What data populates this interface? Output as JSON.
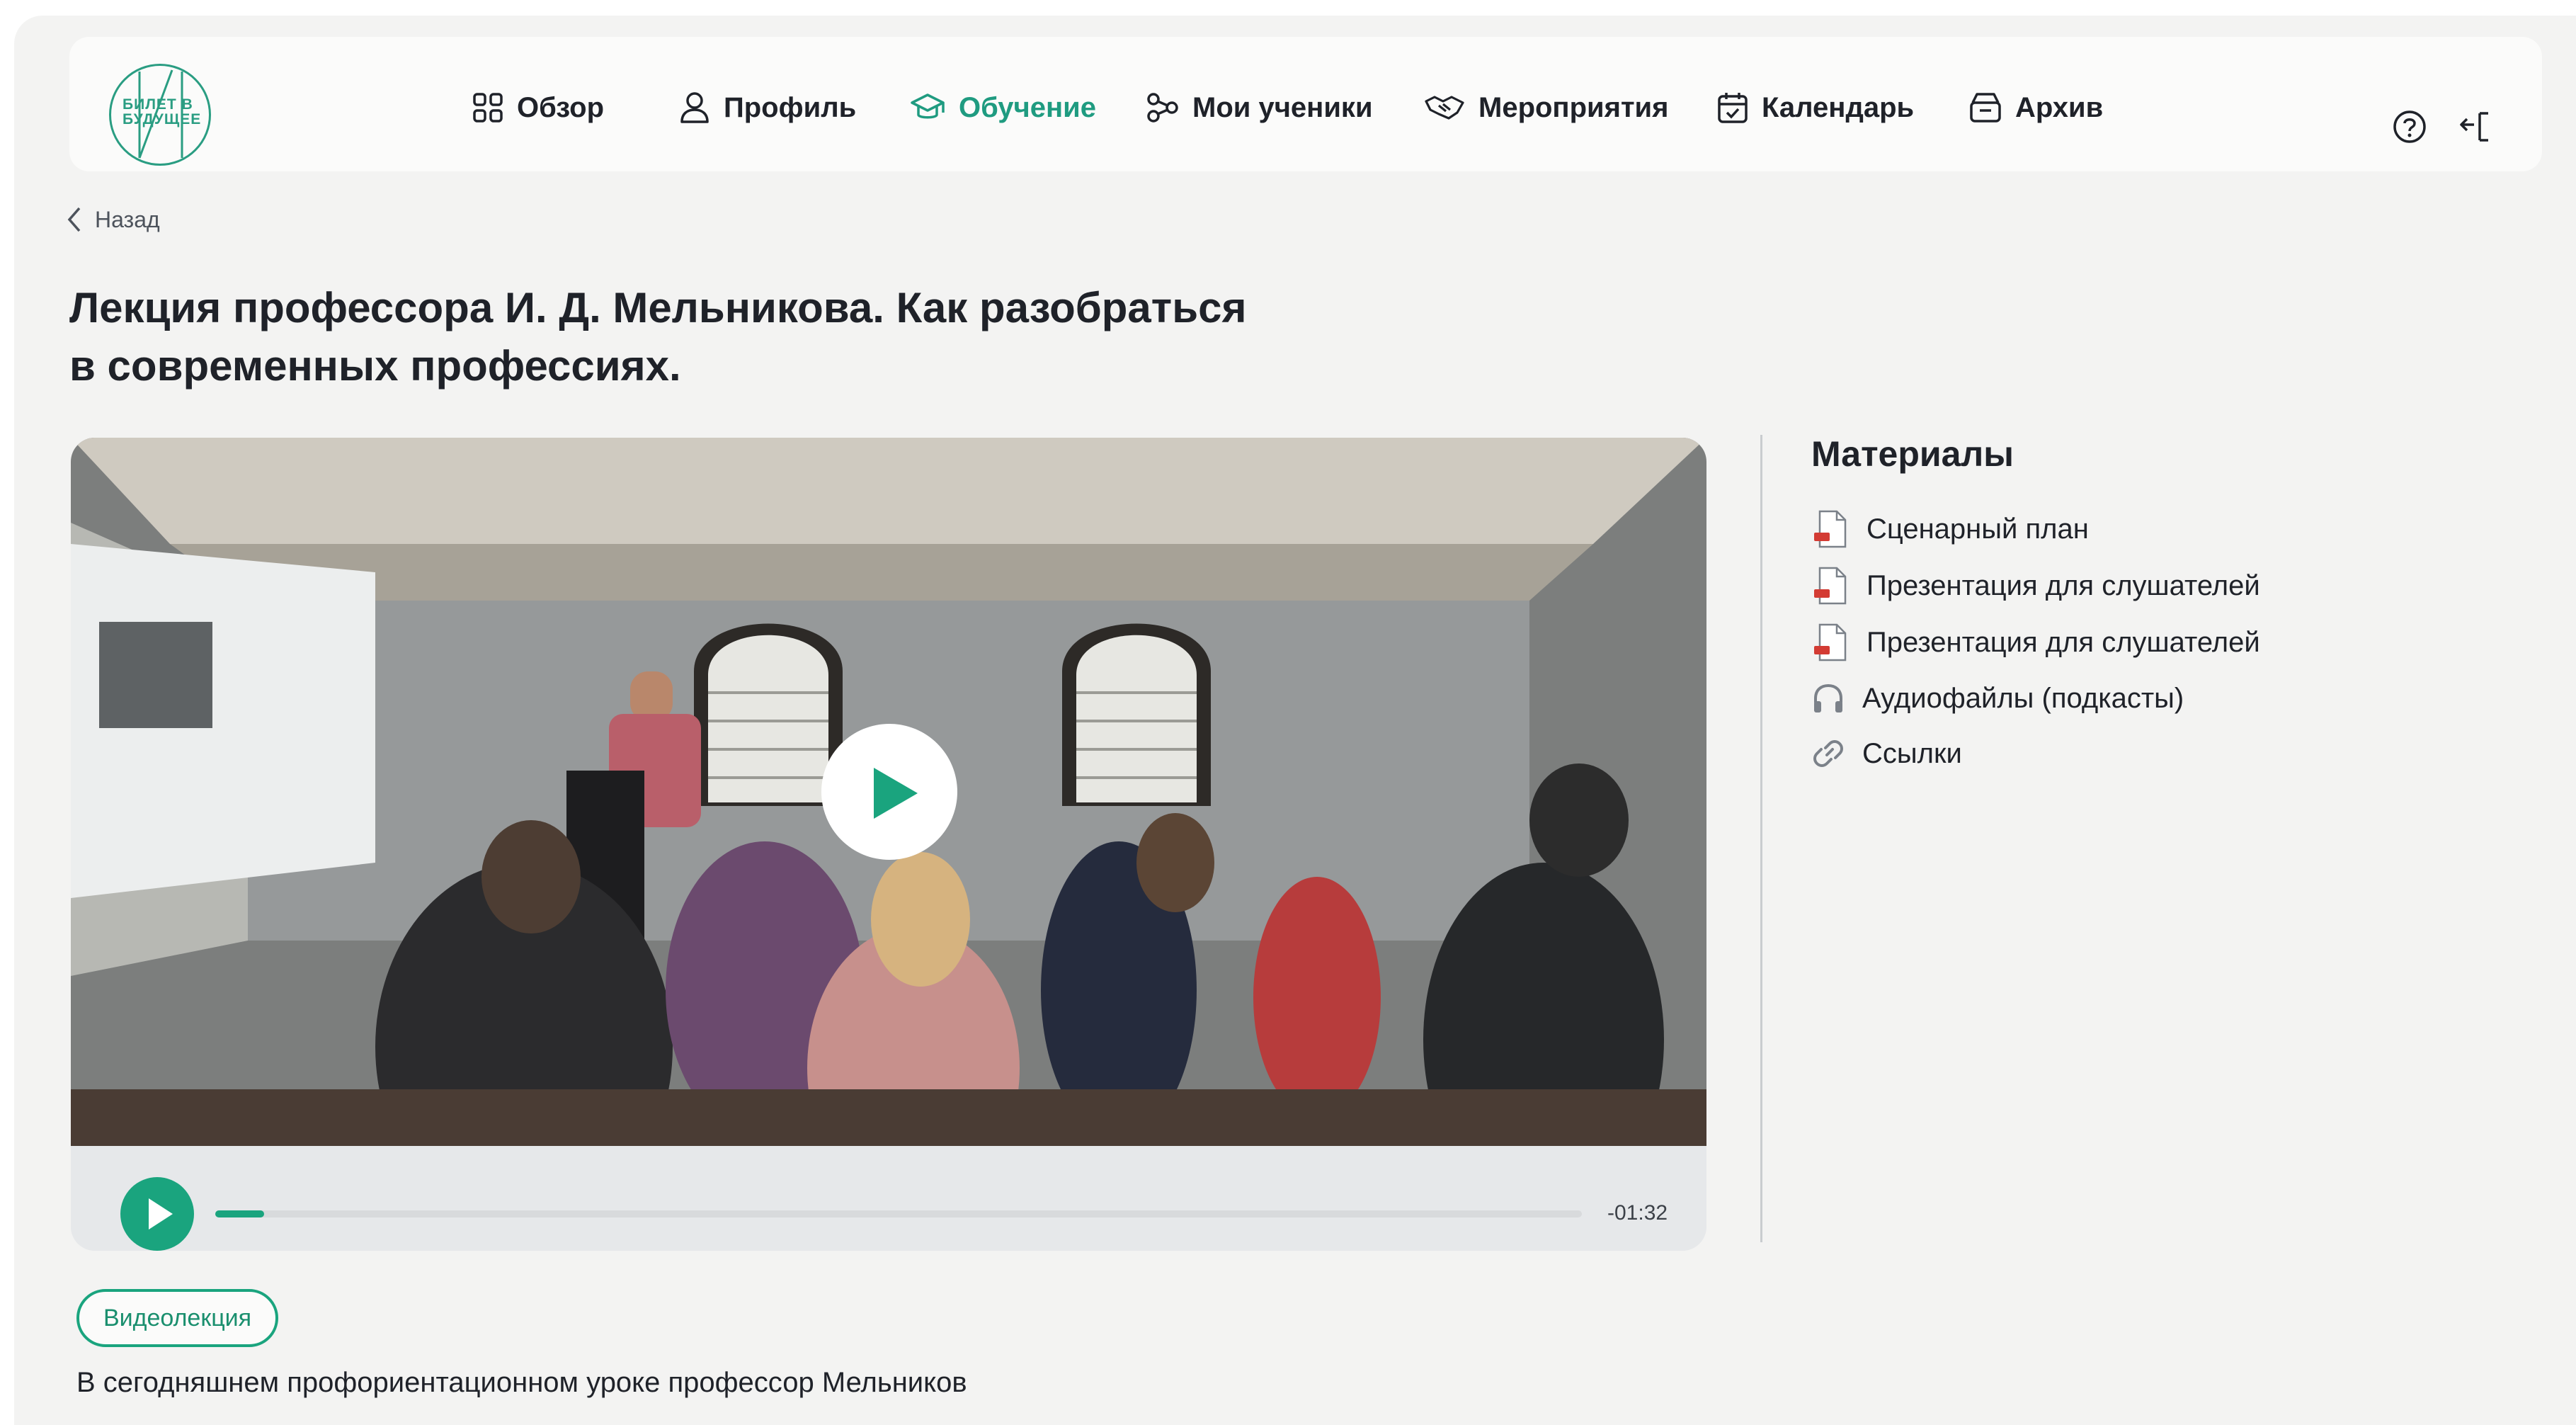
{
  "brand": {
    "logo_text_1": "БИЛЕТ В",
    "logo_text_2": "БУДУЩЕЕ"
  },
  "nav": {
    "items": [
      {
        "label": "Обзор",
        "icon": "grid-icon"
      },
      {
        "label": "Профиль",
        "icon": "user-icon"
      },
      {
        "label": "Обучение",
        "icon": "graduation-cap-icon",
        "active": true
      },
      {
        "label": "Мои ученики",
        "icon": "network-icon"
      },
      {
        "label": "Мероприятия",
        "icon": "handshake-icon"
      },
      {
        "label": "Календарь",
        "icon": "calendar-icon"
      },
      {
        "label": "Архив",
        "icon": "archive-icon"
      }
    ],
    "tools": [
      "help-icon",
      "logout-icon"
    ]
  },
  "back": {
    "label": "Назад"
  },
  "page": {
    "title_line1": "Лекция профессора И. Д. Мельникова. Как разобраться",
    "title_line2": "в современных профессиях."
  },
  "video": {
    "time_remaining": "-01:32",
    "progress": 0.036
  },
  "materials": {
    "title": "Материалы",
    "items": [
      {
        "label": "Сценарный план",
        "icon": "pdf-file-icon"
      },
      {
        "label": "Презентация для слушателей",
        "icon": "pdf-file-icon"
      },
      {
        "label": "Презентация для слушателей",
        "icon": "pdf-file-icon"
      },
      {
        "label": "Аудиофайлы (подкасты)",
        "icon": "headphones-icon"
      },
      {
        "label": "Ссылки",
        "icon": "link-icon"
      }
    ]
  },
  "tag": {
    "label": "Видеолекция"
  },
  "description": {
    "text": "В сегодняшнем профориентационном уроке профессор Мельников"
  },
  "colors": {
    "accent": "#1aa47e",
    "background": "#f3f3f2",
    "text": "#1f2229"
  }
}
